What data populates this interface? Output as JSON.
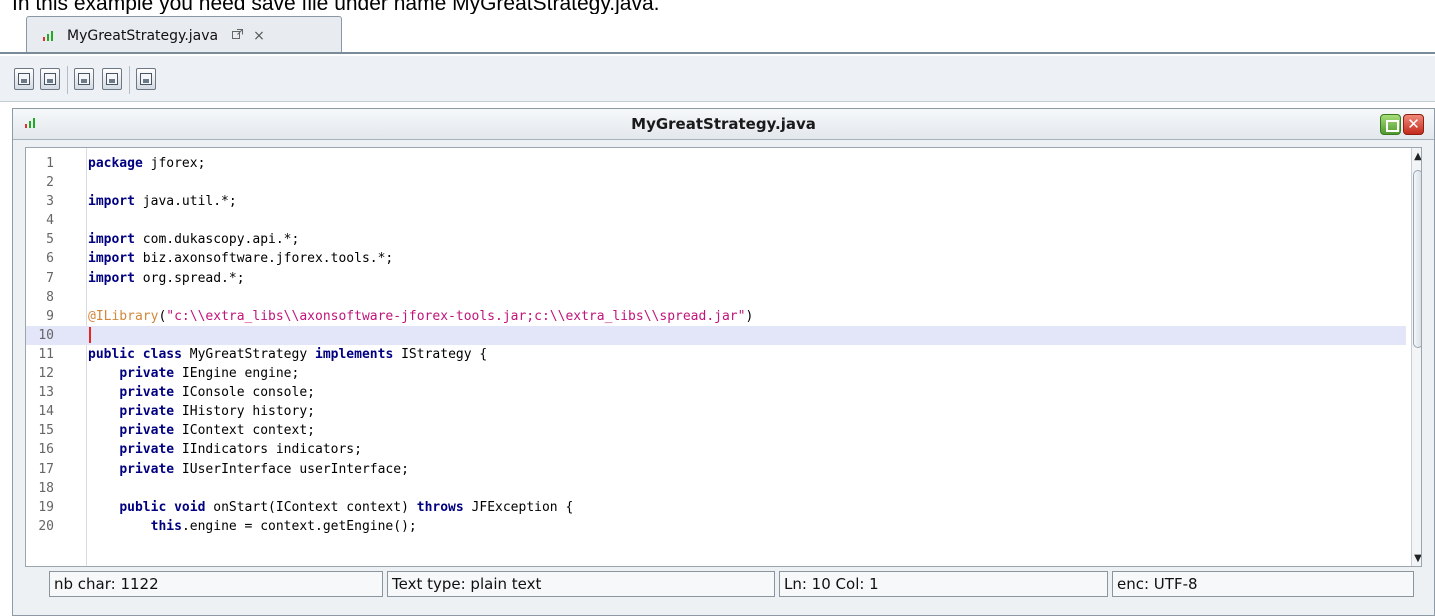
{
  "caption": "In this example you need save file under name MyGreatStrategy.java.",
  "tab": {
    "label": "MyGreatStrategy.java",
    "popout_icon": "popout-icon",
    "close_glyph": "×"
  },
  "toolbar": {
    "buttons": [
      "save-icon",
      "save-as-icon",
      "compile-icon",
      "compile-run-icon",
      "compile-jfx-icon"
    ]
  },
  "editor": {
    "title": "MyGreatStrategy.java",
    "close_glyph": "✕",
    "lines": [
      {
        "n": "1",
        "code": "package jforex;"
      },
      {
        "n": "2",
        "code": ""
      },
      {
        "n": "3",
        "code": "import java.util.*;"
      },
      {
        "n": "4",
        "code": ""
      },
      {
        "n": "5",
        "code": "import com.dukascopy.api.*;"
      },
      {
        "n": "6",
        "code": "import biz.axonsoftware.jforex.tools.*;"
      },
      {
        "n": "7",
        "code": "import org.spread.*;"
      },
      {
        "n": "8",
        "code": ""
      },
      {
        "n": "9",
        "code": "@ILibrary(\"c:\\\\extra_libs\\\\axonsoftware-jforex-tools.jar;c:\\\\extra_libs\\\\spread.jar\")"
      },
      {
        "n": "10",
        "code": ""
      },
      {
        "n": "11",
        "code": "public class MyGreatStrategy implements IStrategy {"
      },
      {
        "n": "12",
        "code": "    private IEngine engine;"
      },
      {
        "n": "13",
        "code": "    private IConsole console;"
      },
      {
        "n": "14",
        "code": "    private IHistory history;"
      },
      {
        "n": "15",
        "code": "    private IContext context;"
      },
      {
        "n": "16",
        "code": "    private IIndicators indicators;"
      },
      {
        "n": "17",
        "code": "    private IUserInterface userInterface;"
      },
      {
        "n": "18",
        "code": ""
      },
      {
        "n": "19",
        "code": "    public void onStart(IContext context) throws JFException {"
      },
      {
        "n": "20",
        "code": "        this.engine = context.getEngine();"
      }
    ],
    "current_line": "10",
    "scroll_up": "▲",
    "scroll_down": "▼"
  },
  "status": {
    "chars": "nb char: 1122",
    "text_type": "Text type: plain text",
    "position": "Ln: 10  Col: 1",
    "encoding": "enc: UTF-8"
  },
  "colors": {
    "keyword": "#000080",
    "annotation": "#d2873a",
    "string": "#c0147a",
    "current_line": "#e3e5f8",
    "caret": "#e8251f"
  }
}
